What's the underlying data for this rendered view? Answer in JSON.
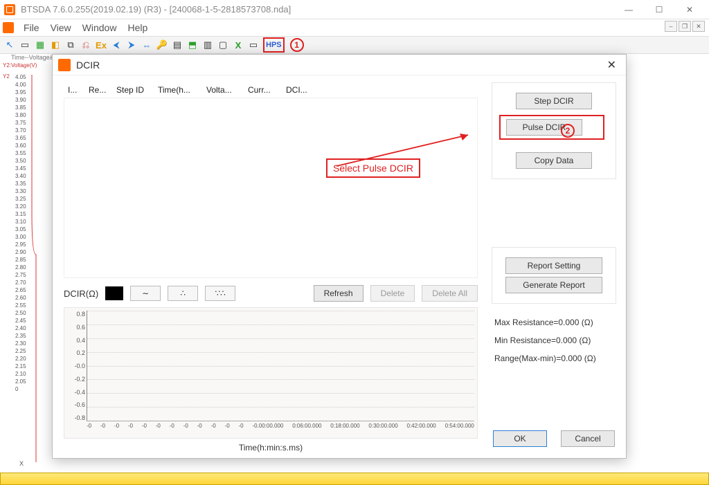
{
  "window": {
    "title": "BTSDA 7.6.0.255(2019.02.19) (R3) - [240068-1-5-2818573708.nda]",
    "minimize": "—",
    "maximize": "☐",
    "close": "✕"
  },
  "menu": {
    "file": "File",
    "view": "View",
    "window": "Window",
    "help": "Help"
  },
  "toolbar": {
    "hps_label": "HPS"
  },
  "callout": {
    "one": "1",
    "two": "2",
    "text": "Select Pulse DCIR"
  },
  "bg": {
    "tab": "Time--Voltage&Curr...",
    "ylabel": "Y2:Voltage(V)",
    "y2": "Y2",
    "x": "X",
    "ticks": [
      "4.05",
      "4.00",
      "3.95",
      "3.90",
      "3.85",
      "3.80",
      "3.75",
      "3.70",
      "3.65",
      "3.60",
      "3.55",
      "3.50",
      "3.45",
      "3.40",
      "3.35",
      "3.30",
      "3.25",
      "3.20",
      "3.15",
      "3.10",
      "3.05",
      "3.00",
      "2.95",
      "2.90",
      "2.85",
      "2.80",
      "2.75",
      "2.70",
      "2.65",
      "2.60",
      "2.55",
      "2.50",
      "2.45",
      "2.40",
      "2.35",
      "2.30",
      "2.25",
      "2.20",
      "2.15",
      "2.10",
      "2.05",
      "0"
    ]
  },
  "dialog": {
    "title": "DCIR",
    "columns": [
      "I...",
      "Re...",
      "Step ID",
      "Time(h...",
      "Volta...",
      "Curr...",
      "DCI..."
    ],
    "dcir_label": "DCIR(Ω)",
    "refresh": "Refresh",
    "delete": "Delete",
    "delete_all": "Delete All",
    "step_dcir": "Step DCIR",
    "pulse_dcir": "Pulse DCIR",
    "copy_data": "Copy Data",
    "report_setting": "Report Setting",
    "generate_report": "Generate Report",
    "stats": {
      "max": "Max Resistance=0.000 (Ω)",
      "min": "Min Resistance=0.000 (Ω)",
      "range": "Range(Max-min)=0.000 (Ω)"
    },
    "ok": "OK",
    "cancel": "Cancel",
    "x_caption": "Time(h:min:s.ms)",
    "style1": "∼",
    "style2": "∴",
    "style3": "∵∴"
  },
  "chart_data": {
    "type": "line",
    "title": "",
    "xlabel": "Time(h:min:s.ms)",
    "ylabel": "DCIR(Ω)",
    "ylim": [
      -0.8,
      0.8
    ],
    "yticks": [
      "0.8",
      "0.6",
      "0.4",
      "0.2",
      "-0.0",
      "-0.2",
      "-0.4",
      "-0.6",
      "-0.8"
    ],
    "xticks": [
      "-0",
      "-0",
      "-0",
      "-0",
      "-0",
      "-0",
      "-0",
      "-0",
      "-0",
      "-0",
      "-0",
      "-0",
      "-0.00:00.000",
      "0:06:00.000",
      "0:18:00.000",
      "0:30:00.000",
      "0:42:00.000",
      "0:54:00.000"
    ],
    "series": [
      {
        "name": "DCIR",
        "values": []
      }
    ]
  }
}
